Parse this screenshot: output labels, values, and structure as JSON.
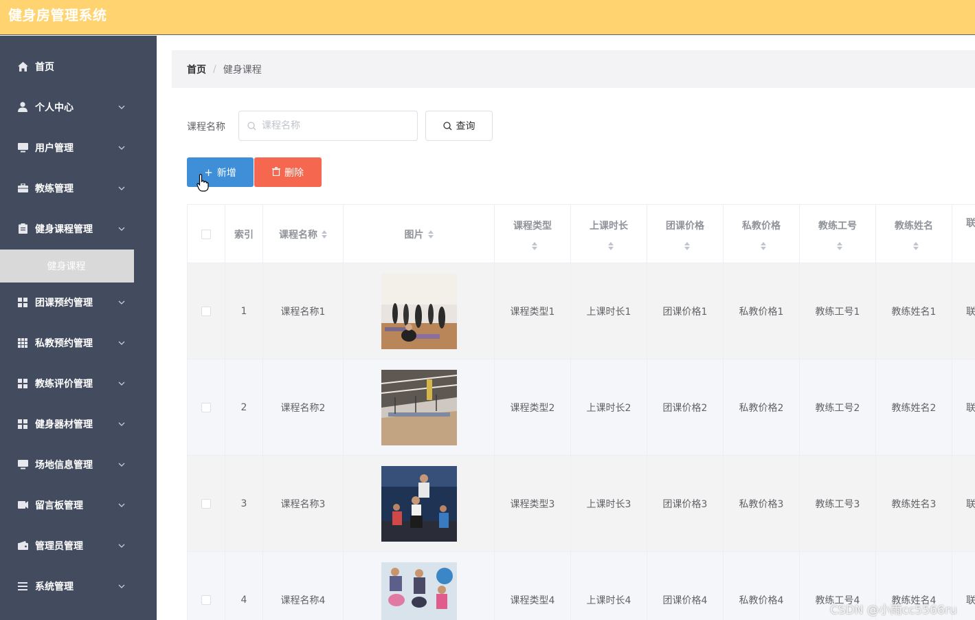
{
  "app": {
    "title": "健身房管理系统"
  },
  "sidebar": {
    "items": [
      {
        "label": "首页",
        "icon": "home-icon",
        "expandable": false
      },
      {
        "label": "个人中心",
        "icon": "user-icon",
        "expandable": true
      },
      {
        "label": "用户管理",
        "icon": "monitor-icon",
        "expandable": true
      },
      {
        "label": "教练管理",
        "icon": "briefcase-icon",
        "expandable": true
      },
      {
        "label": "健身课程管理",
        "icon": "clipboard-icon",
        "expandable": true
      },
      {
        "label": "团课预约管理",
        "icon": "grid-icon",
        "expandable": true
      },
      {
        "label": "私教预约管理",
        "icon": "grid9-icon",
        "expandable": true
      },
      {
        "label": "教练评价管理",
        "icon": "grid-icon",
        "expandable": true
      },
      {
        "label": "健身器材管理",
        "icon": "grid-icon",
        "expandable": true
      },
      {
        "label": "场地信息管理",
        "icon": "monitor-icon",
        "expandable": true
      },
      {
        "label": "留言板管理",
        "icon": "message-icon",
        "expandable": true
      },
      {
        "label": "管理员管理",
        "icon": "wallet-icon",
        "expandable": true
      },
      {
        "label": "系统管理",
        "icon": "list-icon",
        "expandable": true
      }
    ],
    "active_subitem": "健身课程"
  },
  "breadcrumb": {
    "home": "首页",
    "separator": "/",
    "current": "健身课程"
  },
  "search": {
    "label": "课程名称",
    "placeholder": "课程名称",
    "value": "",
    "button": "查询"
  },
  "actions": {
    "add": "新增",
    "delete": "删除"
  },
  "table": {
    "columns": [
      "索引",
      "课程名称",
      "图片",
      "课程类型",
      "上课时长",
      "团课价格",
      "私教价格",
      "教练工号",
      "教练姓名",
      "联"
    ],
    "rows": [
      {
        "index": "1",
        "name": "课程名称1",
        "type": "课程类型1",
        "duration": "上课时长1",
        "group_price": "团课价格1",
        "private_price": "私教价格1",
        "coach_id": "教练工号1",
        "coach_name": "教练姓名1",
        "more": "联"
      },
      {
        "index": "2",
        "name": "课程名称2",
        "type": "课程类型2",
        "duration": "上课时长2",
        "group_price": "团课价格2",
        "private_price": "私教价格2",
        "coach_id": "教练工号2",
        "coach_name": "教练姓名2",
        "more": "联"
      },
      {
        "index": "3",
        "name": "课程名称3",
        "type": "课程类型3",
        "duration": "上课时长3",
        "group_price": "团课价格3",
        "private_price": "私教价格3",
        "coach_id": "教练工号3",
        "coach_name": "教练姓名3",
        "more": "联"
      },
      {
        "index": "4",
        "name": "课程名称4",
        "type": "课程类型4",
        "duration": "上课时长4",
        "group_price": "团课价格4",
        "private_price": "私教价格4",
        "coach_id": "教练工号4",
        "coach_name": "教练姓名4",
        "more": "联"
      }
    ]
  },
  "watermark": "CSDN @小雨cc5566ru",
  "colors": {
    "header": "#ffd370",
    "sidebar": "#434c5e",
    "primary": "#3f8ed8",
    "danger": "#f5684f",
    "submenu_active": "#d9d9d9"
  }
}
